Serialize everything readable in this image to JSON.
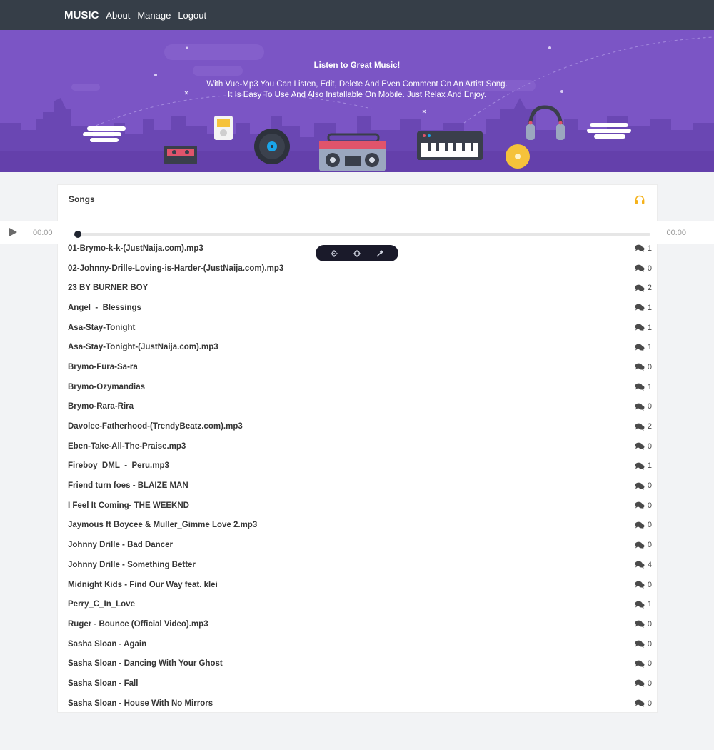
{
  "nav": {
    "brand": "MUSIC",
    "links": [
      "About",
      "Manage",
      "Logout"
    ]
  },
  "hero": {
    "title": "Listen to Great Music!",
    "subtitle_line1": "With Vue-Mp3 You Can Listen, Edit, Delete And Even Comment On An Artist Song.",
    "subtitle_line2": "It Is Easy To Use And Also Installable On Mobile. Just Relax And Enjoy."
  },
  "songs_card": {
    "title": "Songs",
    "header_icon": "headphones-icon"
  },
  "player": {
    "current_time": "00:00",
    "duration": "00:00",
    "progress": 0
  },
  "colors": {
    "navbar": "#363e48",
    "hero": "#7b55c5",
    "accent": "#f5b21b"
  },
  "songs": [
    {
      "name": "01-Brymo-k-k-(JustNaija.com).mp3",
      "comments": "1"
    },
    {
      "name": "02-Johnny-Drille-Loving-is-Harder-(JustNaija.com).mp3",
      "comments": "0"
    },
    {
      "name": "23 BY BURNER BOY",
      "comments": "2"
    },
    {
      "name": "Angel_-_Blessings",
      "comments": "1"
    },
    {
      "name": "Asa-Stay-Tonight",
      "comments": "1"
    },
    {
      "name": "Asa-Stay-Tonight-(JustNaija.com).mp3",
      "comments": "1"
    },
    {
      "name": "Brymo-Fura-Sa-ra",
      "comments": "0"
    },
    {
      "name": "Brymo-Ozymandias",
      "comments": "1"
    },
    {
      "name": "Brymo-Rara-Rira",
      "comments": "0"
    },
    {
      "name": "Davolee-Fatherhood-(TrendyBeatz.com).mp3",
      "comments": "2"
    },
    {
      "name": "Eben-Take-All-The-Praise.mp3",
      "comments": "0"
    },
    {
      "name": "Fireboy_DML_-_Peru.mp3",
      "comments": "1"
    },
    {
      "name": "Friend turn foes - BLAIZE MAN",
      "comments": "0"
    },
    {
      "name": "I Feel It Coming- THE WEEKND",
      "comments": "0"
    },
    {
      "name": "Jaymous ft Boycee & Muller_Gimme Love 2.mp3",
      "comments": "0"
    },
    {
      "name": "Johnny Drille - Bad Dancer",
      "comments": "0"
    },
    {
      "name": "Johnny Drille - Something Better",
      "comments": "4"
    },
    {
      "name": "Midnight Kids - Find Our Way feat. klei",
      "comments": "0"
    },
    {
      "name": "Perry_C_In_Love",
      "comments": "1"
    },
    {
      "name": "Ruger - Bounce (Official Video).mp3",
      "comments": "0"
    },
    {
      "name": "Sasha Sloan - Again",
      "comments": "0"
    },
    {
      "name": "Sasha Sloan - Dancing With Your Ghost",
      "comments": "0"
    },
    {
      "name": "Sasha Sloan - Fall",
      "comments": "0"
    },
    {
      "name": "Sasha Sloan - House With No Mirrors",
      "comments": "0"
    }
  ]
}
